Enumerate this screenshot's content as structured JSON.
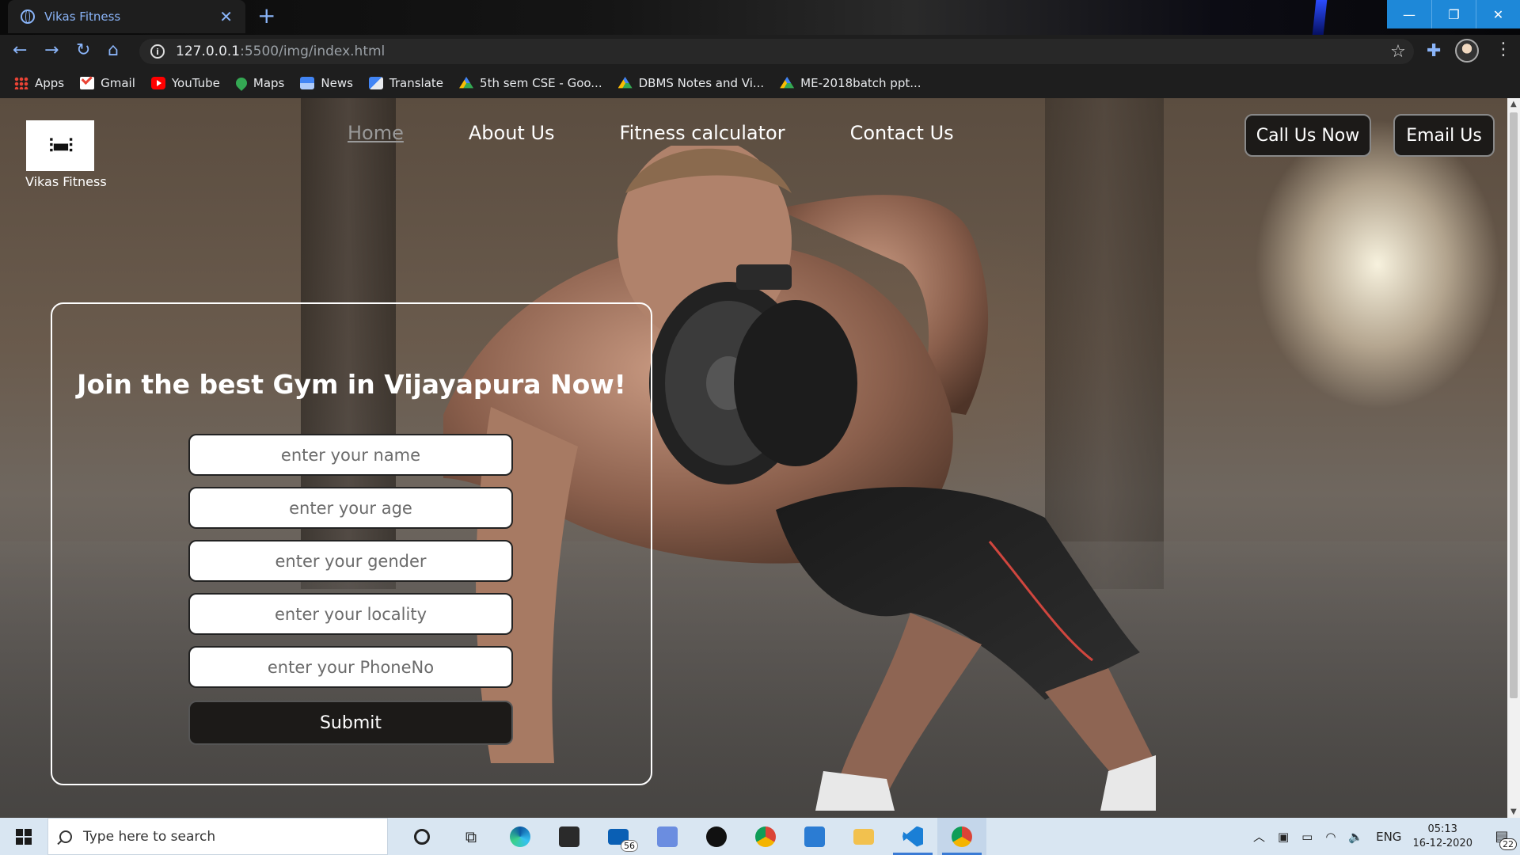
{
  "browser": {
    "tab_title": "Vikas Fitness",
    "tab_close": "✕",
    "new_tab": "+",
    "url_host": "127.0.0.1",
    "url_path": ":5500/img/index.html",
    "window_buttons": [
      "—",
      "❐",
      "✕"
    ]
  },
  "bookmarks": [
    {
      "label": "Apps",
      "icon": "apps-grid-icon"
    },
    {
      "label": "Gmail",
      "icon": "gmail-icon"
    },
    {
      "label": "YouTube",
      "icon": "youtube-icon"
    },
    {
      "label": "Maps",
      "icon": "maps-icon"
    },
    {
      "label": "News",
      "icon": "news-icon"
    },
    {
      "label": "Translate",
      "icon": "translate-icon"
    },
    {
      "label": "5th sem CSE - Goo...",
      "icon": "drive-icon"
    },
    {
      "label": "DBMS Notes and Vi...",
      "icon": "drive-icon"
    },
    {
      "label": "ME-2018batch ppt...",
      "icon": "drive-icon"
    }
  ],
  "site": {
    "logo_text": "Vikas Fitness",
    "nav": [
      "Home",
      "About Us",
      "Fitness calculator",
      "Contact Us"
    ],
    "call_label": "Call Us Now",
    "email_label": "Email Us",
    "join_title": "Join the best Gym in Vijayapura Now!",
    "fields": [
      {
        "placeholder": "enter your name"
      },
      {
        "placeholder": "enter your age"
      },
      {
        "placeholder": "enter your gender"
      },
      {
        "placeholder": "enter your locality"
      },
      {
        "placeholder": "enter your PhoneNo"
      }
    ],
    "submit_label": "Submit"
  },
  "taskbar": {
    "search_placeholder": "Type here to search",
    "mail_badge": "56",
    "lang": "ENG",
    "time": "05:13",
    "date": "16-12-2020",
    "notifications": "22"
  },
  "colors": {
    "accent_blue": "#8ab4f8",
    "button_dark": "#1c1a18",
    "taskbar_bg": "#d9e6f2"
  }
}
